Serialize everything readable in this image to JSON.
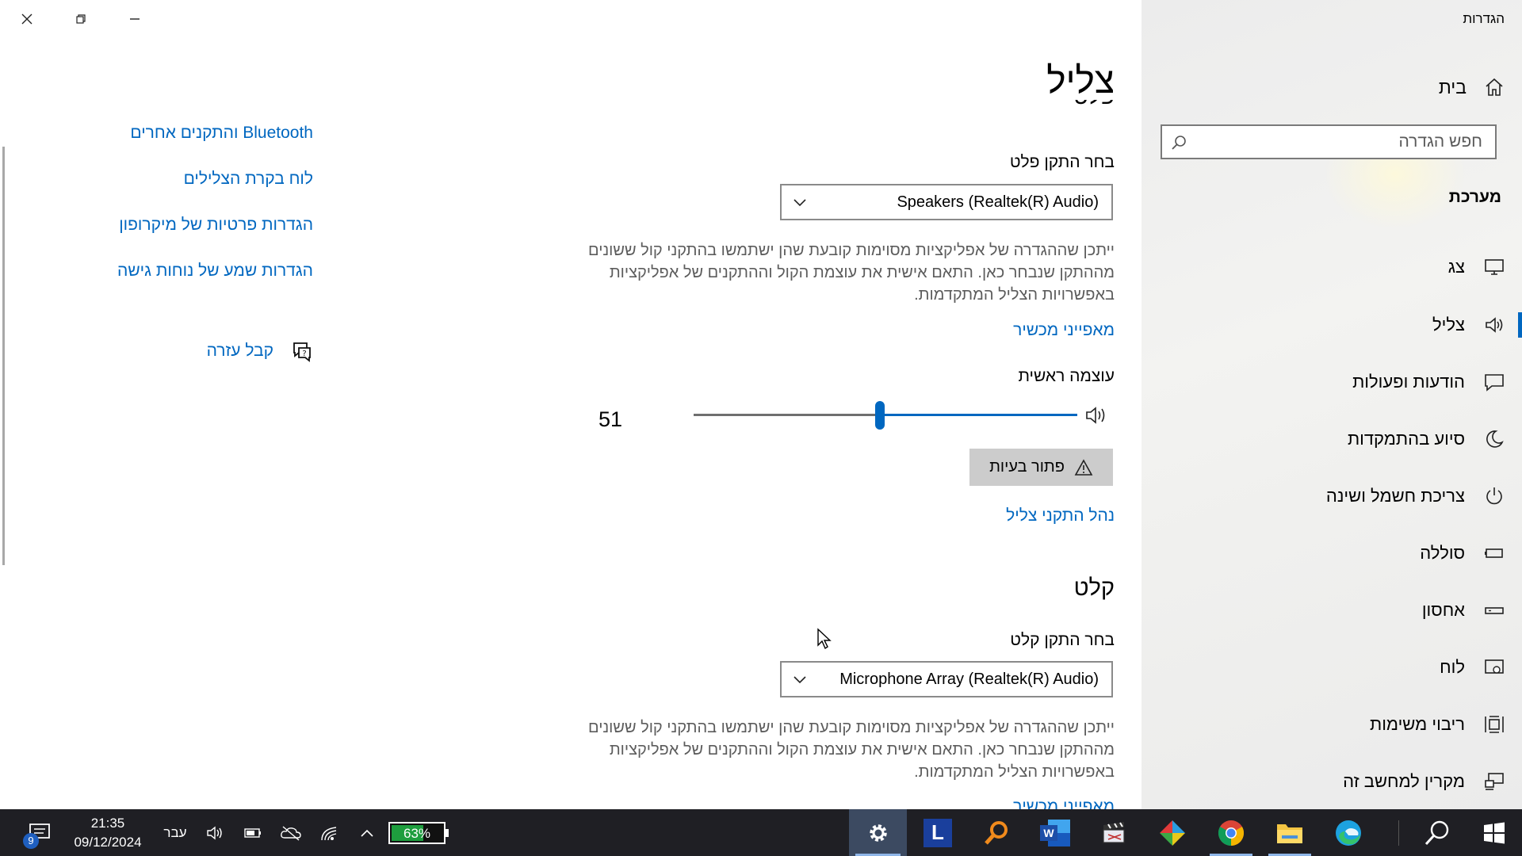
{
  "window": {
    "title": "הגדרות"
  },
  "nav": {
    "home_label": "בית",
    "search_placeholder": "חפש הגדרה",
    "section_label": "מערכת",
    "items": [
      {
        "label": "צג",
        "icon": "display-icon"
      },
      {
        "label": "צליל",
        "icon": "speaker-icon",
        "selected": true
      },
      {
        "label": "הודעות ופעולות",
        "icon": "message-icon"
      },
      {
        "label": "סיוע בהתמקדות",
        "icon": "moon-icon"
      },
      {
        "label": "צריכת חשמל ושינה",
        "icon": "power-icon"
      },
      {
        "label": "סוללה",
        "icon": "battery-icon"
      },
      {
        "label": "אחסון",
        "icon": "storage-icon"
      },
      {
        "label": "לוח",
        "icon": "tablet-icon"
      },
      {
        "label": "ריבוי משימות",
        "icon": "multitasking-icon"
      },
      {
        "label": "מקרין למחשב זה",
        "icon": "projecting-icon"
      }
    ]
  },
  "main": {
    "page_title": "צליל",
    "output": {
      "heading_partial": "פלט",
      "choose_label": "בחר התקן פלט",
      "device": "Speakers (Realtek(R) Audio)",
      "description": "ייתכן שההגדרה של אפליקציות מסוימות קובעת שהן ישתמשו בהתקני קול ששונים מההתקן שנבחר כאן. התאם אישית את עוצמת הקול וההתקנים של אפליקציות באפשרויות הצליל המתקדמות.",
      "device_properties_link": "מאפייני מכשיר",
      "master_volume_label": "עוצמה ראשית",
      "volume_value": "51",
      "volume_level": 51,
      "troubleshoot_label": "פתור בעיות",
      "manage_devices_link": "נהל התקני צליל"
    },
    "input": {
      "heading": "קלט",
      "choose_label": "בחר התקן קלט",
      "device": "Microphone Array (Realtek(R) Audio)",
      "description": "ייתכן שההגדרה של אפליקציות מסוימות קובעת שהן ישתמשו בהתקני קול ששונים מההתקן שנבחר כאן. התאם אישית את עוצמת הקול וההתקנים של אפליקציות באפשרויות הצליל המתקדמות.",
      "device_properties_link_partial": "מאפייני מכשיר"
    }
  },
  "related": {
    "links": [
      "Bluetooth והתקנים אחרים",
      "לוח בקרת הצלילים",
      "הגדרות פרטיות של מיקרופון",
      "הגדרות שמע של נוחות גישה"
    ],
    "help_label": "קבל עזרה"
  },
  "taskbar": {
    "notification_count": "9",
    "time": "21:35",
    "date": "09/12/2024",
    "language": "עבר",
    "battery_percent": "63%",
    "battery_level": 63,
    "apps": [
      "settings",
      "L app",
      "search tool",
      "word",
      "clapperboard",
      "colorful app",
      "chrome",
      "file explorer",
      "edge"
    ],
    "app_letter": "L",
    "word_letter": "W"
  },
  "colors": {
    "accent": "#0067c0",
    "taskbar": "#1f1f24",
    "nav_bg": "#efefed",
    "battery_fill": "#1e9e3e"
  }
}
